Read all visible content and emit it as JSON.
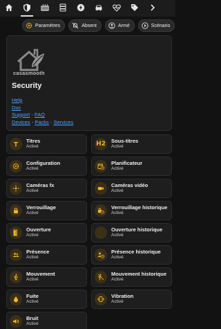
{
  "tabs": [
    {
      "icon": "home-icon"
    },
    {
      "icon": "shield-icon"
    },
    {
      "icon": "radiator-icon"
    },
    {
      "icon": "server-icon"
    },
    {
      "icon": "lightning-icon"
    },
    {
      "icon": "car-icon"
    },
    {
      "icon": "heart-pulse-icon"
    },
    {
      "icon": "tag-icon"
    },
    {
      "icon": "chevron-right-icon"
    }
  ],
  "chips": [
    {
      "label": "Paramètres",
      "icon": "gear-icon"
    },
    {
      "label": "Absent",
      "icon": "bell-off-icon"
    },
    {
      "label": "Armé",
      "icon": "user-circle-icon"
    },
    {
      "label": "Scénario",
      "icon": "play-circle-icon"
    }
  ],
  "info": {
    "logo_text": "casasmooth",
    "title": "Security",
    "links": {
      "help": "Help",
      "doc": "Doc",
      "support": "Support",
      "dash": " - ",
      "faq": "FAQ",
      "devices": "Devices",
      "packs": "Packs",
      "services": "Services"
    }
  },
  "accent_color": "#f0b429",
  "entities": [
    {
      "name": "Titres",
      "state": "Activé",
      "icon": "text-t-icon"
    },
    {
      "name": "Sous-titres",
      "state": "Activé",
      "icon": "h2-icon"
    },
    {
      "name": "Configuration",
      "state": "Activé",
      "icon": "gear-icon"
    },
    {
      "name": "Planificateur",
      "state": "Activé",
      "icon": "calendar-clock-icon"
    },
    {
      "name": "Caméras fx",
      "state": "Activé",
      "icon": "pan-camera-icon"
    },
    {
      "name": "Caméras vidéo",
      "state": "Activé",
      "icon": "video-camera-icon"
    },
    {
      "name": "Verrouillage",
      "state": "Activé",
      "icon": "lock-icon"
    },
    {
      "name": "Verrouillage historique",
      "state": "Activé",
      "icon": "lock-history-icon"
    },
    {
      "name": "Ouverture",
      "state": "Activé",
      "icon": "door-open-icon"
    },
    {
      "name": "Ouverture historique",
      "state": "Activé",
      "icon": "blank-icon"
    },
    {
      "name": "Présence",
      "state": "Activé",
      "icon": "people-icon"
    },
    {
      "name": "Présence historique",
      "state": "Activé",
      "icon": "presence-history-icon"
    },
    {
      "name": "Mouvement",
      "state": "Activé",
      "icon": "walk-icon"
    },
    {
      "name": "Mouvement historique",
      "state": "Activé",
      "icon": "walk-history-icon"
    },
    {
      "name": "Fuite",
      "state": "Activé",
      "icon": "water-drop-icon"
    },
    {
      "name": "Vibration",
      "state": "Activé",
      "icon": "vibration-icon"
    },
    {
      "name": "Bruit",
      "state": "Activé",
      "icon": "speaker-icon"
    }
  ]
}
